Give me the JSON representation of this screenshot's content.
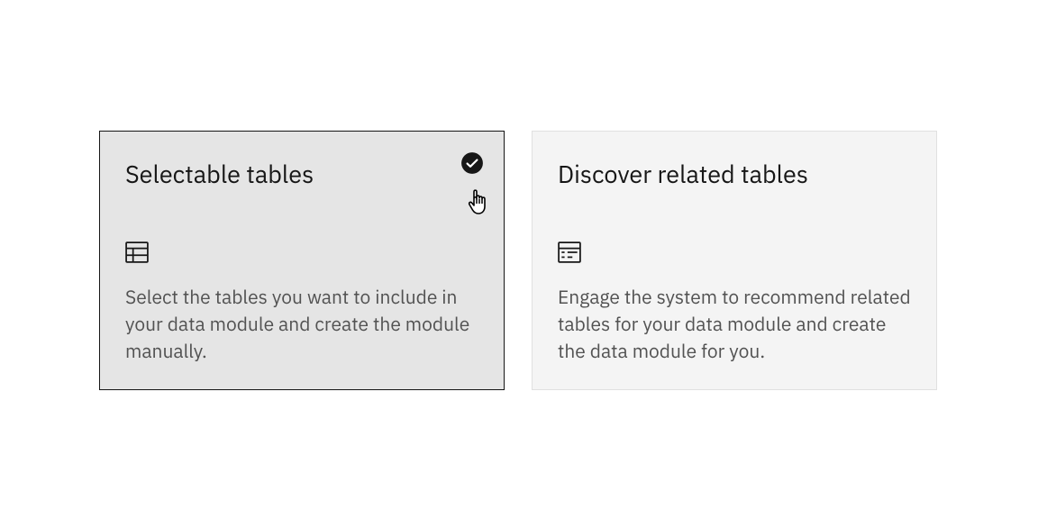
{
  "cards": [
    {
      "title": "Selectable tables",
      "description": "Select the tables you want to include in your data module and create the module manually.",
      "selected": true
    },
    {
      "title": "Discover related tables",
      "description": "Engage the system to recommend related tables for your data module and create the data module for you.",
      "selected": false
    }
  ]
}
